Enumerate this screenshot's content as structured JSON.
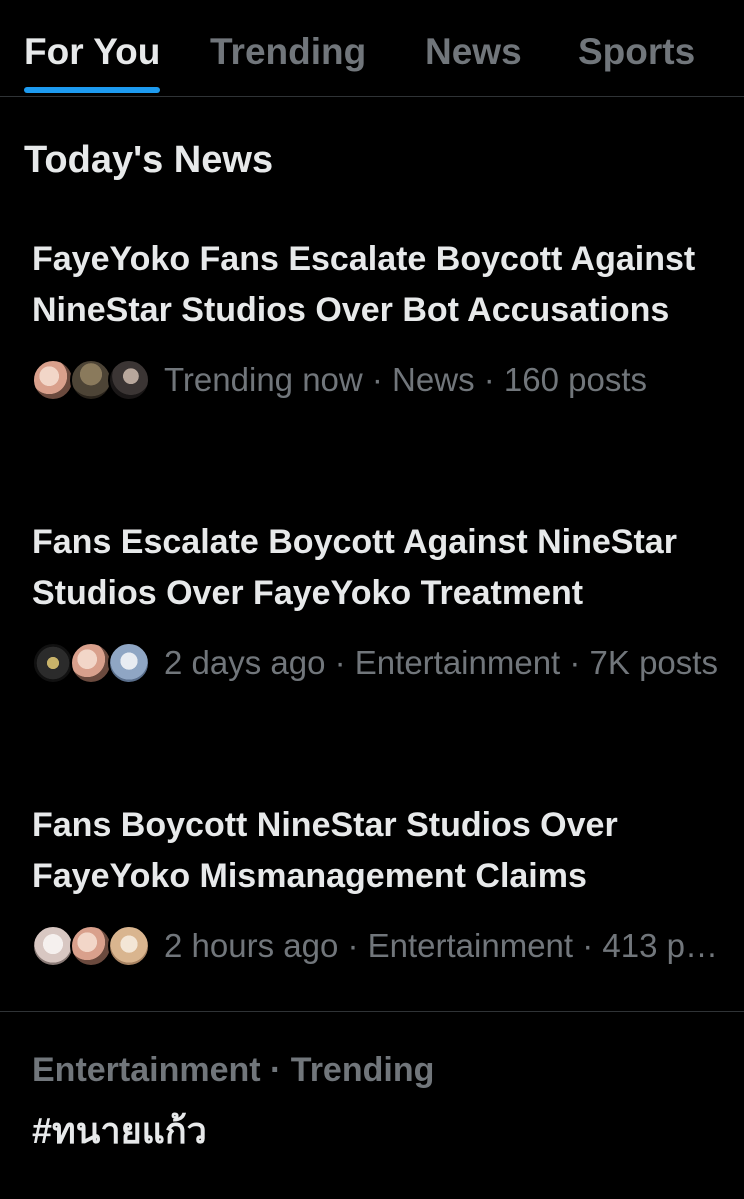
{
  "tabs": [
    {
      "label": "For You",
      "active": true
    },
    {
      "label": "Trending",
      "active": false
    },
    {
      "label": "News",
      "active": false
    },
    {
      "label": "Sports",
      "active": false
    }
  ],
  "colors": {
    "background": "#000000",
    "primary_text": "#e7e9ea",
    "secondary_text": "#71767b",
    "accent": "#1d9bf0",
    "divider": "#2f3336"
  },
  "section": {
    "title": "Today's News"
  },
  "news": [
    {
      "headline": "FayeYoko Fans Escalate Boycott Against NineStar Studios Over Bot Accusations",
      "meta": "Trending now · News · 160 posts",
      "avatars": [
        "avatar-icon",
        "avatar-icon",
        "avatar-icon"
      ]
    },
    {
      "headline": "Fans Escalate Boycott Against NineStar Studios Over FayeYoko Treatment",
      "meta": "2 days ago · Entertainment · 7K posts",
      "avatars": [
        "avatar-icon",
        "avatar-icon",
        "avatar-icon"
      ]
    },
    {
      "headline": "Fans Boycott NineStar Studios Over FayeYoko Mismanagement Claims",
      "meta": "2 hours ago · Entertainment · 413 posts",
      "avatars": [
        "avatar-icon",
        "avatar-icon",
        "avatar-icon"
      ]
    }
  ],
  "trend": {
    "meta": "Entertainment · Trending",
    "tag": "#ทนายแก้ว"
  }
}
